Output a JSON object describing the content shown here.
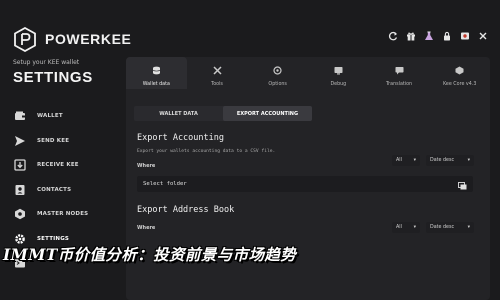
{
  "brand": {
    "name": "POWERKEE"
  },
  "sidebar": {
    "setup_text": "Setup your KEE wallet",
    "title": "SETTINGS",
    "items": [
      {
        "label": "WALLET",
        "icon": "wallet-icon"
      },
      {
        "label": "SEND KEE",
        "icon": "send-icon"
      },
      {
        "label": "RECEIVE KEE",
        "icon": "receive-icon"
      },
      {
        "label": "CONTACTS",
        "icon": "contacts-icon"
      },
      {
        "label": "MASTER NODES",
        "icon": "masternode-icon"
      },
      {
        "label": "SETTINGS",
        "icon": "settings-icon"
      },
      {
        "label": "",
        "icon": "terminal-icon"
      }
    ]
  },
  "topbar": {
    "icons": [
      "refresh-icon",
      "gift-icon",
      "flask-icon",
      "lock-icon",
      "flag-icon",
      "close-icon"
    ]
  },
  "tabs": [
    {
      "label": "Wallet data",
      "icon": "database-icon",
      "active": true
    },
    {
      "label": "Tools",
      "icon": "tools-icon"
    },
    {
      "label": "Options",
      "icon": "options-icon"
    },
    {
      "label": "Debug",
      "icon": "debug-icon"
    },
    {
      "label": "Translation",
      "icon": "translation-icon"
    },
    {
      "label": "Kee Core v4.3",
      "icon": "core-icon"
    }
  ],
  "subtabs": [
    {
      "label": "WALLET DATA"
    },
    {
      "label": "EXPORT ACCOUNTING",
      "active": true
    }
  ],
  "export_accounting": {
    "title": "Export Accounting",
    "description": "Export your wallets accounting data to a CSV file.",
    "where_label": "Where",
    "filter_value": "All",
    "sort_value": "Date desc",
    "folder_placeholder": "Select folder"
  },
  "export_address_book": {
    "title": "Export Address Book",
    "where_label": "Where",
    "filter_value": "All",
    "sort_value": "Date desc"
  },
  "overlay": {
    "title": "IMMT币价值分析：投资前景与市场趋势"
  },
  "colors": {
    "background": "#1b1b1d",
    "panel": "#232326",
    "accent": "#ffffff"
  }
}
